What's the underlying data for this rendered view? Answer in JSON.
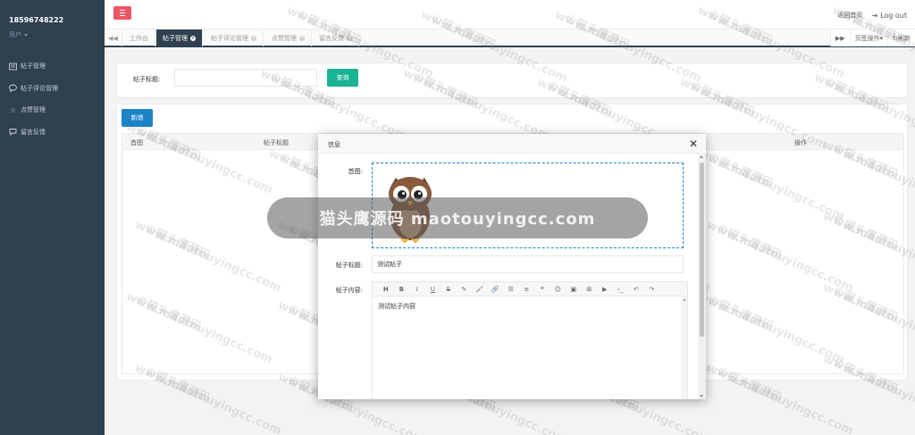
{
  "sidebar": {
    "user_name": "18596748222",
    "user_role": "用户",
    "items": [
      {
        "label": "帖子管理",
        "icon": "list-icon"
      },
      {
        "label": "帖子评论管理",
        "icon": "comment-icon"
      },
      {
        "label": "点赞管理",
        "icon": "star-icon"
      },
      {
        "label": "留言反馈",
        "icon": "feedback-icon"
      }
    ]
  },
  "header": {
    "home_link": "返回首页",
    "logout": "Log out"
  },
  "tabs": {
    "items": [
      "工作台",
      "帖子管理",
      "帖子评论管理",
      "点赞管理",
      "留言反馈"
    ],
    "active_index": 1,
    "page_ops": "页签操作",
    "refresh": "刷新"
  },
  "search": {
    "label": "帖子标题:",
    "value": "",
    "button": "查询"
  },
  "list": {
    "add_button": "新增",
    "columns": [
      "首图",
      "帖子标题",
      "操作"
    ]
  },
  "modal": {
    "title": "信息",
    "cover_label": "首图:",
    "title_label": "帖子标题:",
    "title_value": "测试帖子",
    "content_label": "帖子内容:",
    "content_value": "测试帖子内容"
  },
  "watermark": {
    "text_cn": "©猫头鹰源码",
    "text_url": "www.maotouyingcc.com",
    "banner": "猫头鹰源码 maotouyingcc.com"
  },
  "colors": {
    "sidebar": "#2f4050",
    "danger": "#ed5565",
    "primary": "#1ab394",
    "info": "#1c84c6"
  }
}
